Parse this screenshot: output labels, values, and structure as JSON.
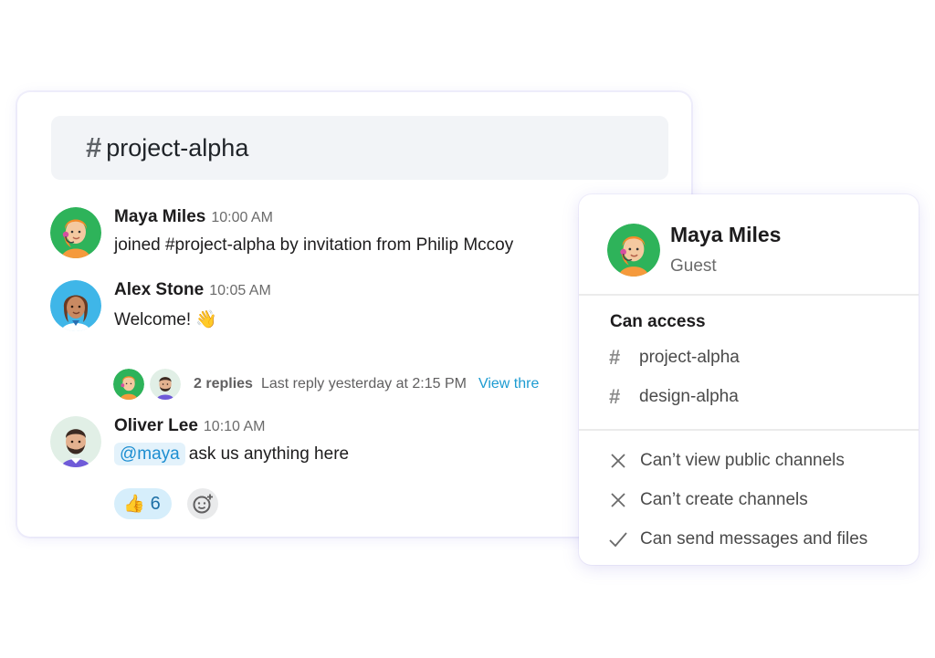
{
  "channel": {
    "hash": "#",
    "name": "project-alpha"
  },
  "messages": [
    {
      "sender": "Maya Miles",
      "time": "10:00 AM",
      "text": "joined #project-alpha by invitation from Philip Mccoy"
    },
    {
      "sender": "Alex Stone",
      "time": "10:05 AM",
      "text": "Welcome! 👋"
    },
    {
      "sender": "Oliver Lee",
      "time": "10:10 AM",
      "mention": "@maya",
      "text": "ask us anything here"
    }
  ],
  "thread": {
    "replies": "2 replies",
    "last_reply": "Last reply yesterday at 2:15 PM",
    "view_link": "View thre"
  },
  "reaction": {
    "emoji": "👍",
    "count": "6"
  },
  "profile": {
    "name": "Maya Miles",
    "role": "Guest",
    "access_title": "Can access",
    "channels": [
      {
        "hash": "#",
        "name": "project-alpha"
      },
      {
        "hash": "#",
        "name": "design-alpha"
      }
    ],
    "permissions": [
      {
        "icon": "x-icon",
        "label": "Can’t view public channels"
      },
      {
        "icon": "x-icon",
        "label": "Can’t create channels"
      },
      {
        "icon": "check-icon",
        "label": "Can send messages and files"
      }
    ]
  },
  "colors": {
    "accent_link": "#1d9bd1",
    "mention_bg": "#e3f2fb",
    "reaction_bg": "#d6eefb",
    "header_bg": "#f2f4f7",
    "avatar_maya_bg": "#2eb35a",
    "avatar_alex_bg": "#3fb6e8",
    "avatar_oliver_bg": "#e1efe6"
  }
}
